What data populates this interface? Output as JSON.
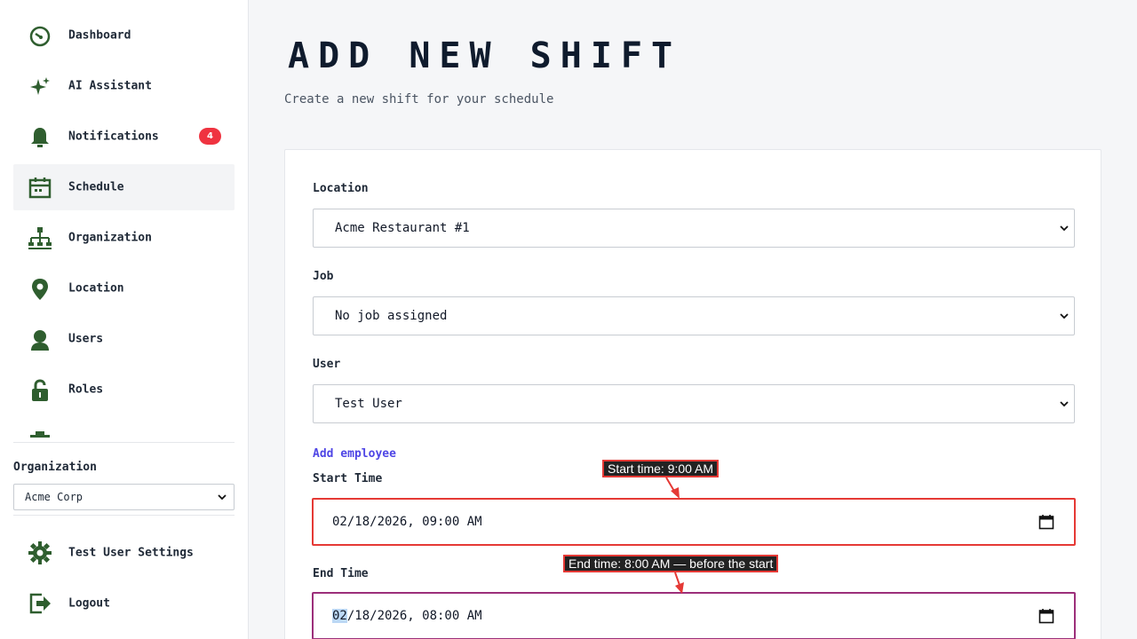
{
  "sidebar": {
    "nav": [
      {
        "label": "Dashboard",
        "icon": "dashboard-icon"
      },
      {
        "label": "AI Assistant",
        "icon": "sparkle-icon"
      },
      {
        "label": "Notifications",
        "icon": "bell-icon",
        "badge": "4"
      },
      {
        "label": "Schedule",
        "icon": "calendar-icon",
        "active": true
      },
      {
        "label": "Organization",
        "icon": "org-chart-icon"
      },
      {
        "label": "Location",
        "icon": "location-pin-icon"
      },
      {
        "label": "Users",
        "icon": "user-icon"
      },
      {
        "label": "Roles",
        "icon": "lock-icon"
      }
    ],
    "organization_label": "Organization",
    "organization_selected": "Acme Corp",
    "settings_label": "Test User Settings",
    "logout_label": "Logout"
  },
  "main": {
    "title": "ADD NEW SHIFT",
    "subtitle": "Create a new shift for your schedule",
    "form": {
      "location_label": "Location",
      "location_value": "Acme Restaurant #1",
      "job_label": "Job",
      "job_value": "No job assigned",
      "user_label": "User",
      "user_value": "Test User",
      "add_employee_link": "Add employee",
      "start_time_label": "Start Time",
      "start_time_value": "02/18/2026, 09:00 AM",
      "end_time_label": "End Time",
      "end_time_selected_segment": "02",
      "end_time_rest": "/18/2026, 08:00 AM"
    }
  },
  "annotations": {
    "start": "Start time: 9:00 AM",
    "end": "End time: 8:00 AM — before the start"
  },
  "colors": {
    "accent_green": "#2f5e2f",
    "badge_red": "#ef3340",
    "error_border": "#e53935",
    "link_indigo": "#4f46e5"
  }
}
